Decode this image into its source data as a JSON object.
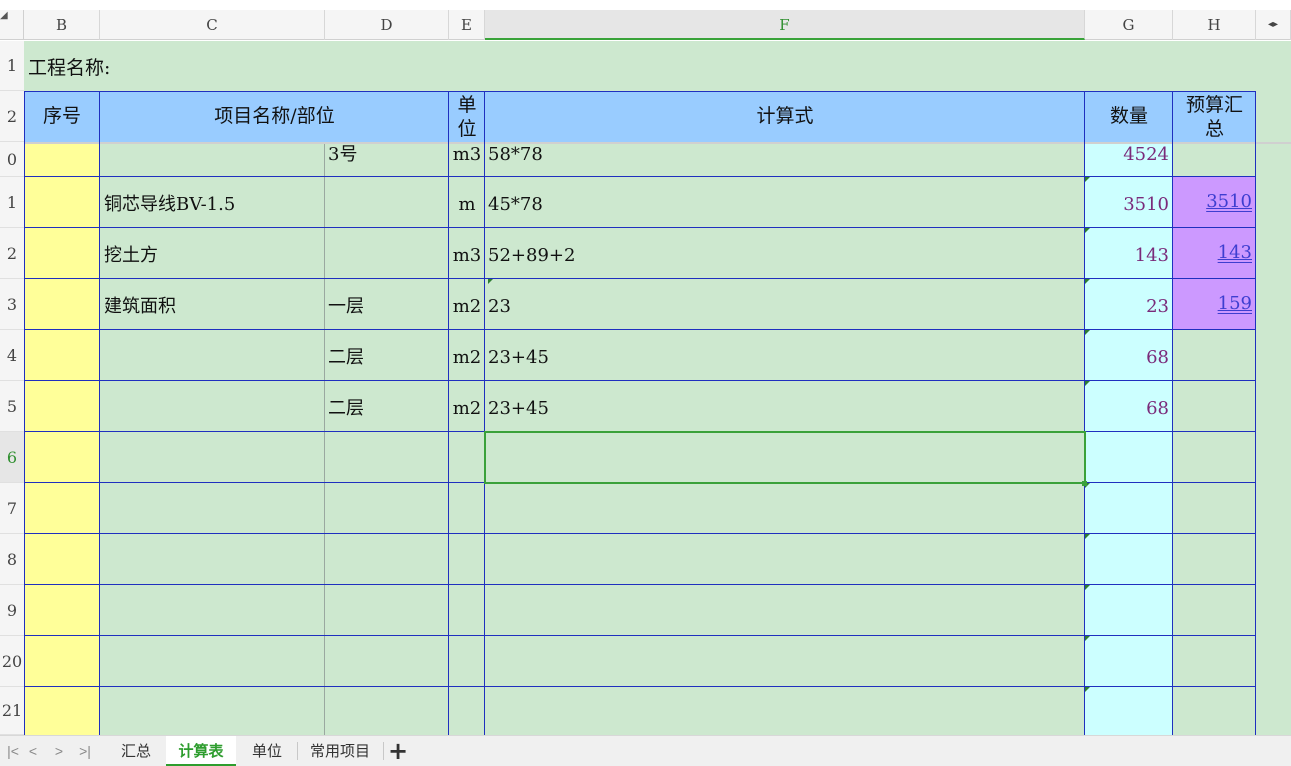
{
  "columns": [
    "B",
    "C",
    "D",
    "E",
    "F",
    "G",
    "H"
  ],
  "active_column": "F",
  "row_numbers": [
    "1",
    "2",
    "0",
    "1",
    "2",
    "3",
    "4",
    "5",
    "6",
    "7",
    "8",
    "9",
    "20",
    "21"
  ],
  "project_label": "工程名称:",
  "headers": {
    "seq": "序号",
    "name": "项目名称/部位",
    "unit_line1": "单",
    "unit_line2": "位",
    "formula": "计算式",
    "qty": "数量",
    "budget_line1": "预算汇",
    "budget_line2": "总"
  },
  "rows": [
    {
      "name": "",
      "part": "3号",
      "unit": "m3",
      "formula": "58*78",
      "qty": "4524",
      "budget": ""
    },
    {
      "name": "铜芯导线BV-1.5",
      "part": "",
      "unit": "m",
      "formula": "45*78",
      "qty": "3510",
      "budget": "3510"
    },
    {
      "name": "挖土方",
      "part": "",
      "unit": "m3",
      "formula": "52+89+2",
      "qty": "143",
      "budget": "143"
    },
    {
      "name": "建筑面积",
      "part": "一层",
      "unit": "m2",
      "formula": "23",
      "qty": "23",
      "budget": "159"
    },
    {
      "name": "",
      "part": "二层",
      "unit": "m2",
      "formula": "23+45",
      "qty": "68",
      "budget": ""
    },
    {
      "name": "",
      "part": "二层",
      "unit": "m2",
      "formula": "23+45",
      "qty": "68",
      "budget": ""
    }
  ],
  "tabs": [
    "汇总",
    "计算表",
    "单位",
    "常用项目"
  ],
  "active_tab": "计算表",
  "nav_icons": [
    "first-sheet-icon",
    "prev-sheet-icon",
    "next-sheet-icon",
    "last-sheet-icon"
  ],
  "add_tab_symbol": "+",
  "colors": {
    "sheet_bg": "#cde8cf",
    "header_bg": "#99ccff",
    "seq_bg": "#ffff99",
    "qty_bg": "#ccffff",
    "budget_highlight": "#cc99ff",
    "grid_line": "#1f2fbf",
    "selection": "#3aa13a"
  }
}
